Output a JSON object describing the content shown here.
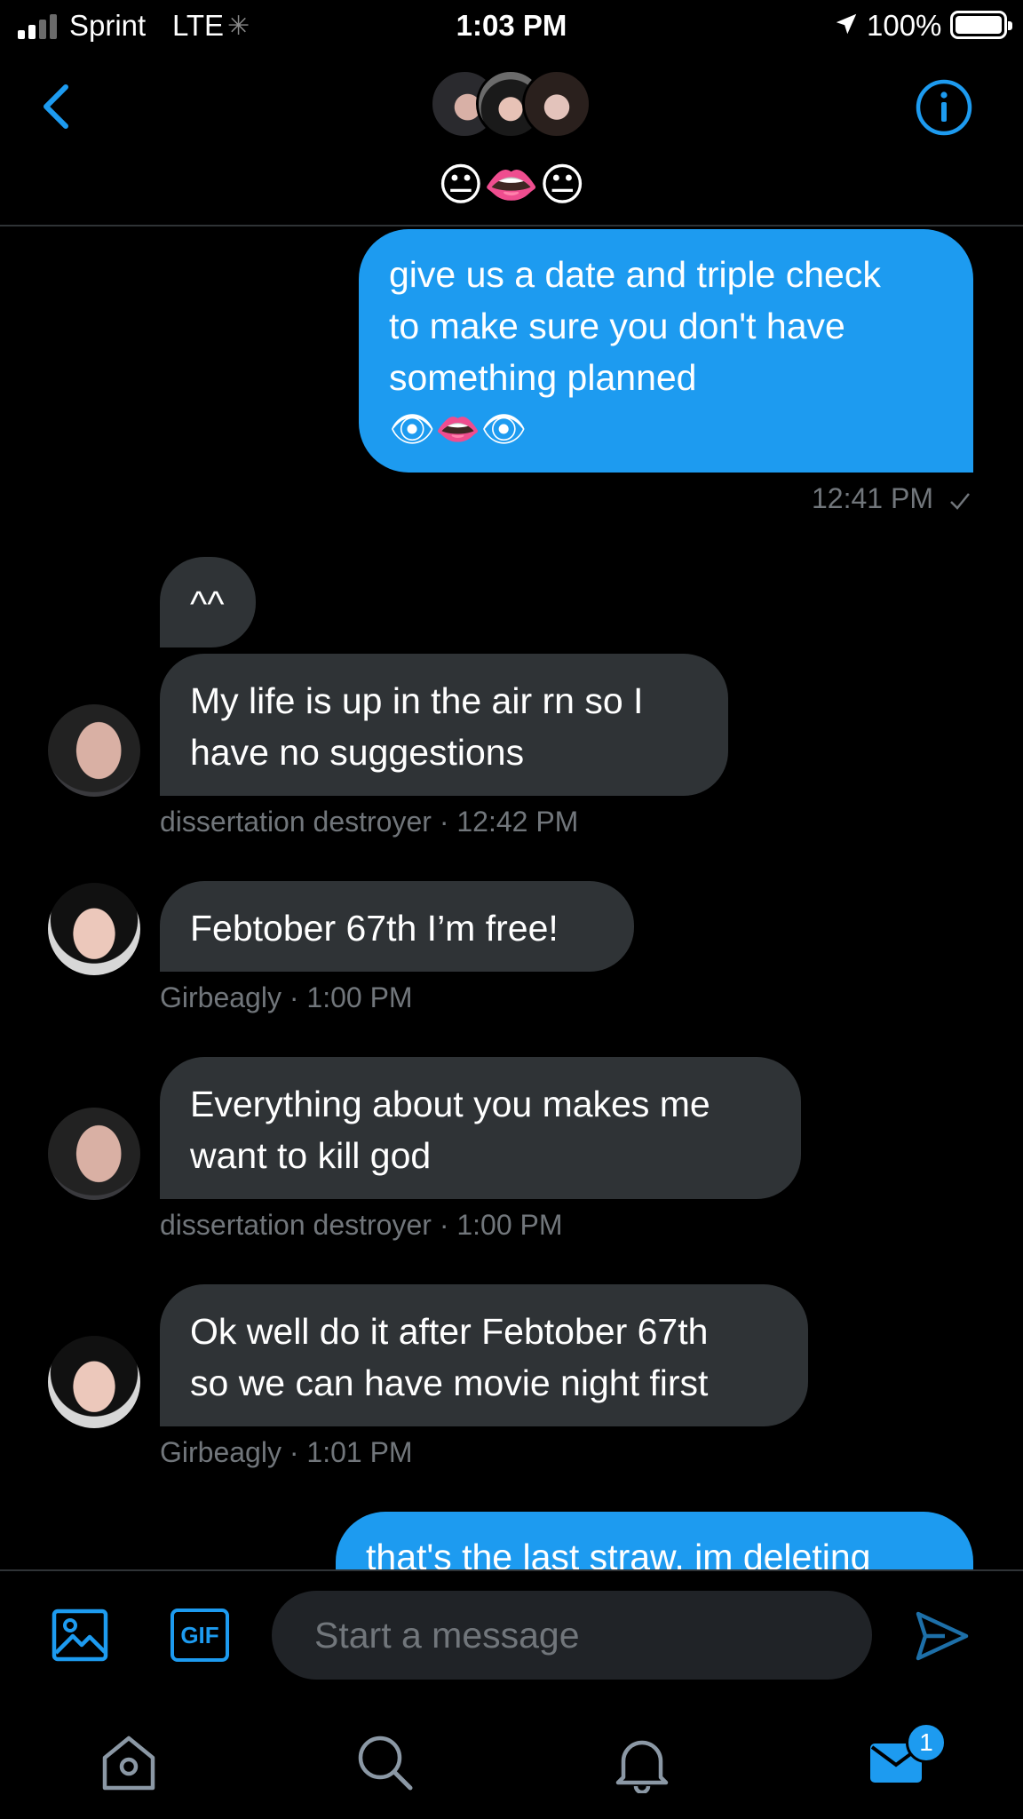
{
  "status_bar": {
    "carrier": "Sprint",
    "network": "LTE",
    "time": "1:03 PM",
    "battery": "100%",
    "icons": [
      "signal-icon",
      "spinner-icon",
      "location-arrow-icon",
      "battery-icon"
    ]
  },
  "header": {
    "group_name": "😐👄😐",
    "icons": [
      "back-chevron-icon",
      "info-icon"
    ]
  },
  "messages": [
    {
      "direction": "out",
      "lines": [
        "give us a date and triple check",
        "to make sure you don't have",
        "something planned",
        "👁👄👁"
      ],
      "time": "12:41 PM"
    },
    {
      "direction": "in",
      "sender": "dissertation destroyer",
      "lines": [
        "^^"
      ]
    },
    {
      "direction": "in",
      "sender": "dissertation destroyer",
      "lines": [
        "My life is up in the air rn so I",
        "have no suggestions"
      ],
      "meta": "dissertation destroyer · 12:42 PM"
    },
    {
      "direction": "in",
      "sender": "Girbeagly",
      "lines": [
        "Febtober 67th I’m free!"
      ],
      "meta": "Girbeagly · 1:00 PM"
    },
    {
      "direction": "in",
      "sender": "dissertation destroyer",
      "lines": [
        "Everything about you makes me",
        "want to kill god"
      ],
      "meta": "dissertation destroyer · 1:00 PM"
    },
    {
      "direction": "in",
      "sender": "Girbeagly",
      "lines": [
        "Ok well do it after Febtober 67th",
        "so we can have movie night first"
      ],
      "meta": "Girbeagly · 1:01 PM"
    },
    {
      "direction": "out",
      "lines": [
        "that's the last straw. im deleting"
      ]
    }
  ],
  "composer": {
    "placeholder": "Start a message",
    "gif_label": "GIF",
    "icons": [
      "image-icon",
      "send-icon"
    ]
  },
  "tabbar": {
    "tabs": [
      "home",
      "search",
      "notifications",
      "messages"
    ],
    "messages_badge": "1",
    "colors": {
      "accent": "#1d9bf0",
      "incoming_bubble": "#2f3336",
      "meta_text": "#71767b"
    }
  }
}
